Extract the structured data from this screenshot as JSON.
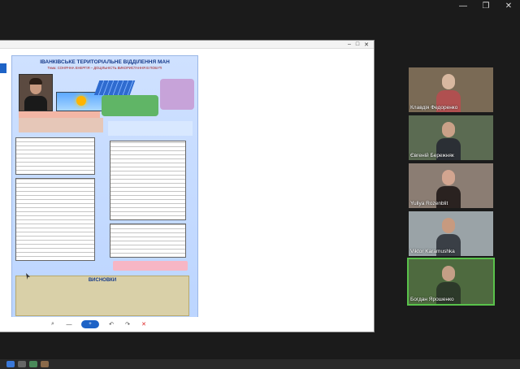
{
  "window_controls": {
    "minimize": "—",
    "restore": "❐",
    "close": "✕"
  },
  "doc_window": {
    "titlebar": {
      "min": "–",
      "max": "□",
      "close": "✕"
    },
    "poster": {
      "title": "ІВАНКІВСЬКЕ ТЕРИТОРІАЛЬНЕ ВІДДІЛЕННЯ МАН",
      "subtitle": "Тема: СОНЯЧНА ЕНЕРГІЯ – ДОЦІЛЬНІСТЬ ВИКОРИСТАННЯ В ПОБУТІ",
      "conclusions_title": "ВИСНОВКИ"
    },
    "toolbar": {
      "search_icon": "magnifier",
      "zoom_out": "—",
      "zoom_in": "+",
      "rotate_left": "↶",
      "rotate_right": "↷",
      "close": "✕"
    }
  },
  "video_tiles": [
    {
      "name": "Клавдія Федоренко",
      "bg": "#7a6a55",
      "skin": "#d8b8a0",
      "cloth": "#b05050"
    },
    {
      "name": "Євгеній Бережняк",
      "bg": "#5b6b52",
      "skin": "#c9a188",
      "cloth": "#2b2f35"
    },
    {
      "name": "Yuliya Rozenblit",
      "bg": "#8b7d73",
      "skin": "#d2a590",
      "cloth": "#2a2220"
    },
    {
      "name": "Viktor Karamushka",
      "bg": "#9aa3a7",
      "skin": "#c79a7f",
      "cloth": "#3a3f46"
    },
    {
      "name": "Богдан Ярошенко",
      "bg": "#4e6a3f",
      "skin": "#c49f86",
      "cloth": "#2d3a2a"
    }
  ]
}
